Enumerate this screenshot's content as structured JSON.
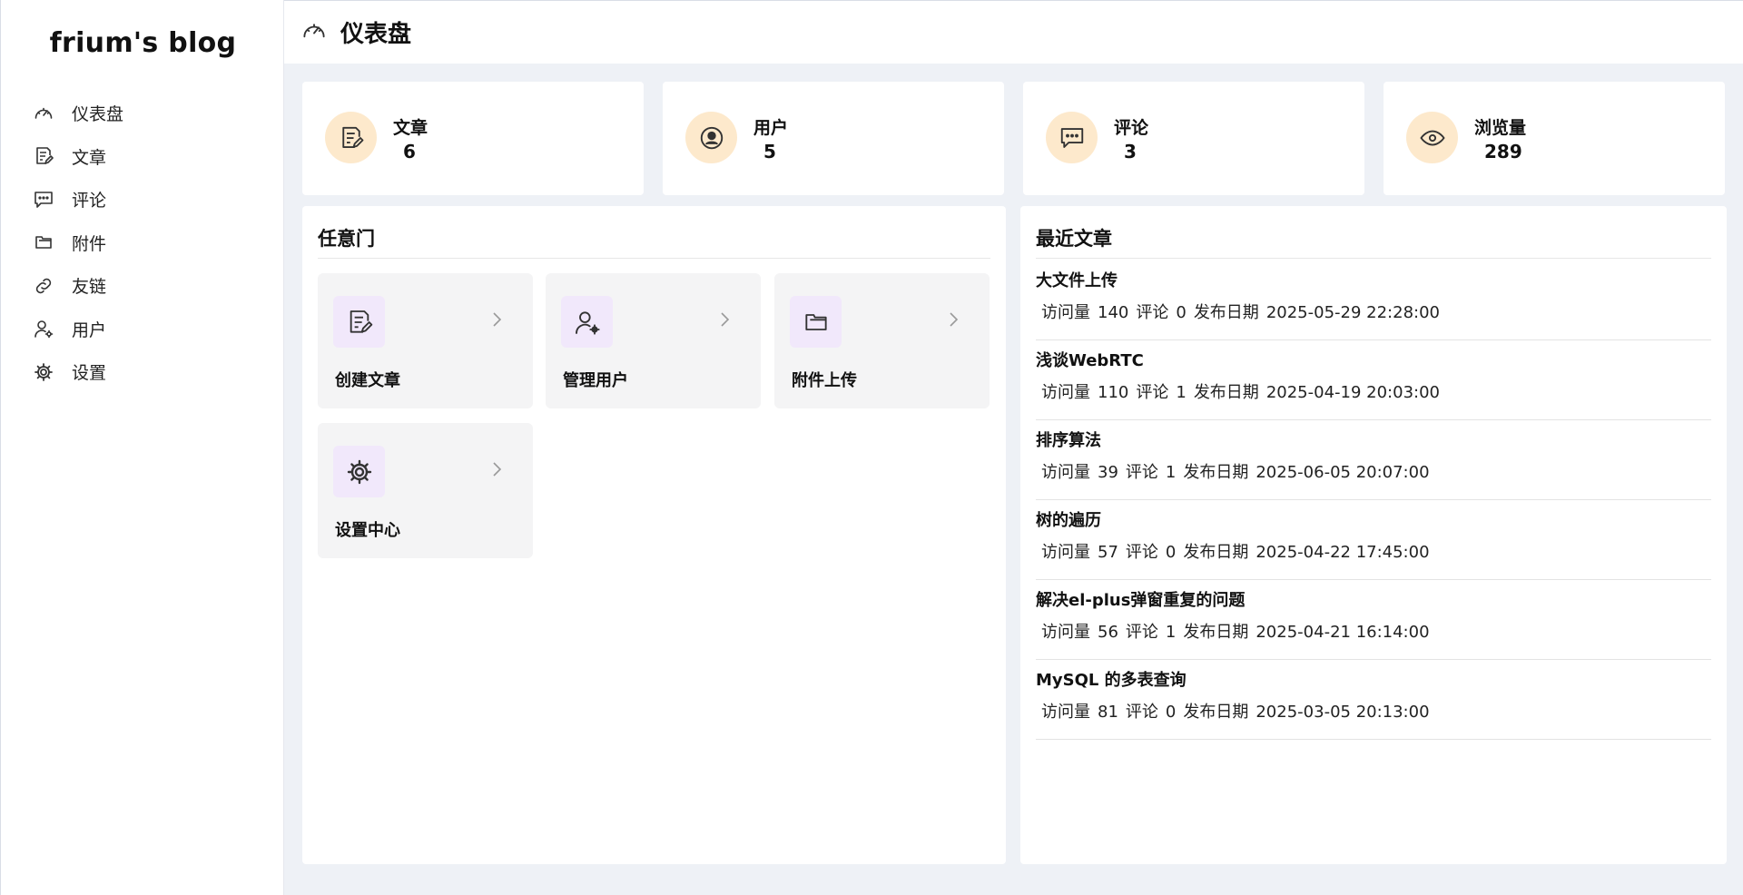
{
  "brand": "frium's blog",
  "sidebar": {
    "items": [
      {
        "label": "仪表盘",
        "icon": "dashboard-icon"
      },
      {
        "label": "文章",
        "icon": "document-edit-icon"
      },
      {
        "label": "评论",
        "icon": "chat-icon"
      },
      {
        "label": "附件",
        "icon": "folder-icon"
      },
      {
        "label": "友链",
        "icon": "link-icon"
      },
      {
        "label": "用户",
        "icon": "user-settings-icon"
      },
      {
        "label": "设置",
        "icon": "gear-icon"
      }
    ]
  },
  "header": {
    "title": "仪表盘",
    "icon": "dashboard-icon"
  },
  "stats": [
    {
      "label": "文章",
      "value": "6",
      "icon": "document-edit-icon"
    },
    {
      "label": "用户",
      "value": "5",
      "icon": "user-circle-icon"
    },
    {
      "label": "评论",
      "value": "3",
      "icon": "chat-icon"
    },
    {
      "label": "浏览量",
      "value": "289",
      "icon": "eye-icon"
    }
  ],
  "quick": {
    "title": "任意门",
    "tiles": [
      {
        "label": "创建文章",
        "icon": "document-edit-icon"
      },
      {
        "label": "管理用户",
        "icon": "user-settings-icon"
      },
      {
        "label": "附件上传",
        "icon": "folder-icon"
      },
      {
        "label": "设置中心",
        "icon": "gear-icon"
      }
    ]
  },
  "recent": {
    "title": "最近文章",
    "views_label": "访问量",
    "comments_label": "评论",
    "date_label": "发布日期",
    "posts": [
      {
        "title": "大文件上传",
        "views": "140",
        "comments": "0",
        "date": "2025-05-29 22:28:00"
      },
      {
        "title": "浅谈WebRTC",
        "views": "110",
        "comments": "1",
        "date": "2025-04-19 20:03:00"
      },
      {
        "title": "排序算法",
        "views": "39",
        "comments": "1",
        "date": "2025-06-05 20:07:00"
      },
      {
        "title": "树的遍历",
        "views": "57",
        "comments": "0",
        "date": "2025-04-22 17:45:00"
      },
      {
        "title": "解决el-plus弹窗重复的问题",
        "views": "56",
        "comments": "1",
        "date": "2025-04-21 16:14:00"
      },
      {
        "title": "MySQL 的多表查询",
        "views": "81",
        "comments": "0",
        "date": "2025-03-05 20:13:00"
      }
    ]
  },
  "colors": {
    "stat_circle": "#fde9cc",
    "tile_bg": "#f4f4f5",
    "tile_icon_bg": "#f1e8fb",
    "main_bg": "#eef1f6"
  }
}
